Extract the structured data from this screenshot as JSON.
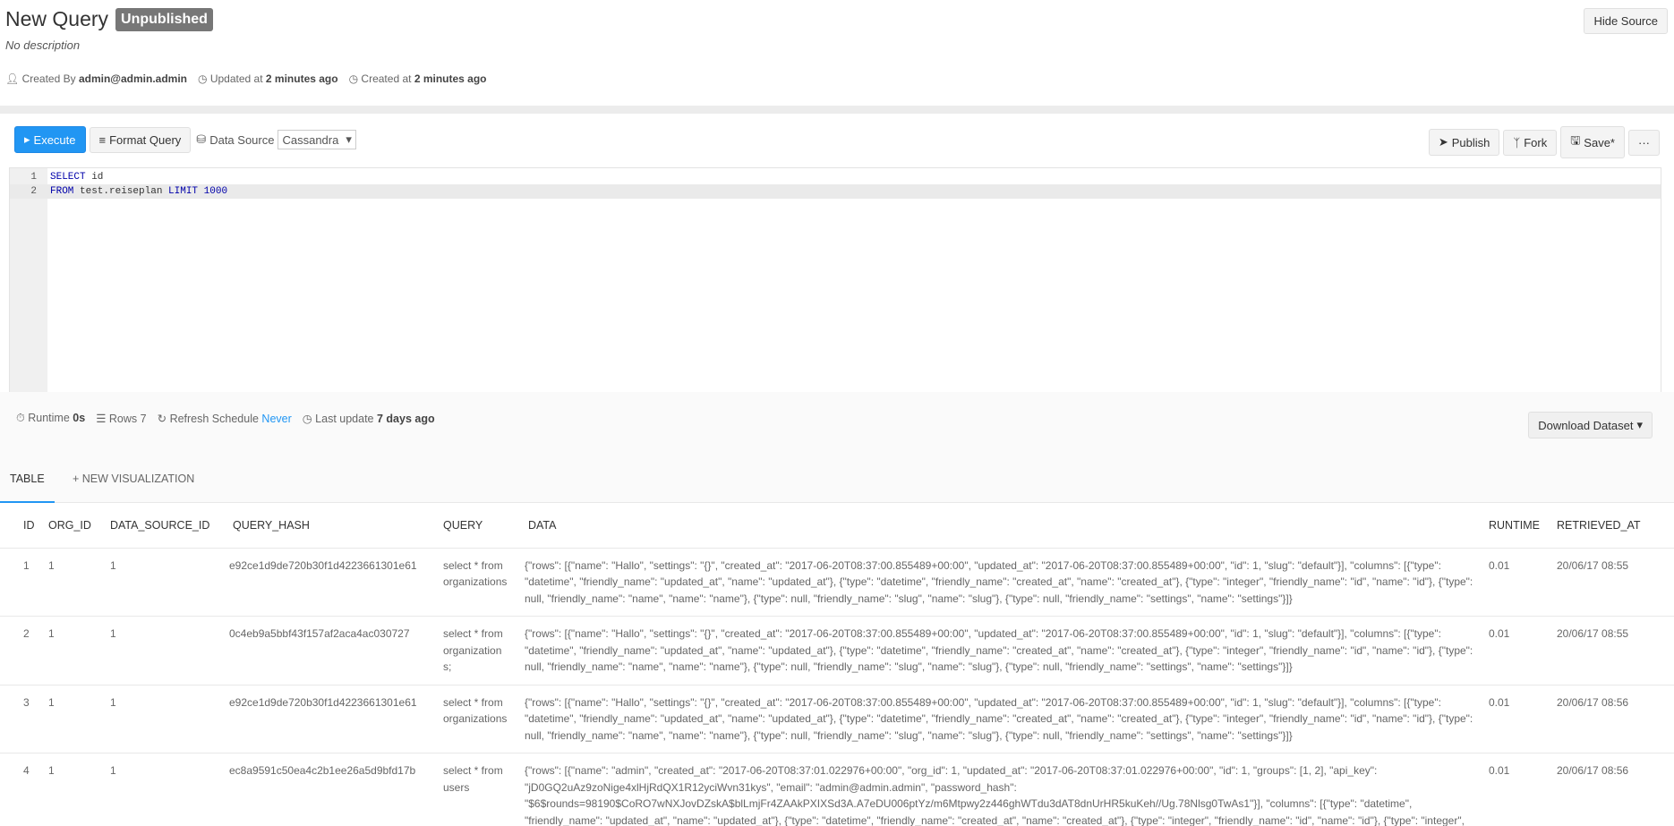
{
  "header": {
    "title": "New Query",
    "badge": "Unpublished",
    "description": "No description",
    "created_by_label": "Created By",
    "created_by": "admin@admin.admin",
    "updated_label": "Updated at",
    "updated_value": "2 minutes ago",
    "created_label": "Created at",
    "created_value": "2 minutes ago",
    "hide_source": "Hide Source"
  },
  "toolbar": {
    "execute": "Execute",
    "format_query": "Format Query",
    "data_source_label": "Data Source",
    "data_source_value": "Cassandra",
    "publish": "Publish",
    "fork": "Fork",
    "save": "Save*",
    "more": "···"
  },
  "editor": {
    "lines": [
      {
        "num": "1",
        "kw1": "SELECT",
        "rest1": " id",
        "kw2": "",
        "rest2": "",
        "num_lit": ""
      },
      {
        "num": "2",
        "kw1": "FROM",
        "rest1": " test.reiseplan ",
        "kw2": "LIMIT",
        "rest2": " ",
        "num_lit": "1000"
      }
    ]
  },
  "results_meta": {
    "runtime_label": "Runtime",
    "runtime_value": "0s",
    "rows_label": "Rows",
    "rows_value": "7",
    "refresh_label": "Refresh Schedule",
    "refresh_value": "Never",
    "last_update_label": "Last update",
    "last_update_value": "7 days ago",
    "download": "Download Dataset"
  },
  "tabs": [
    "TABLE",
    "+ NEW VISUALIZATION"
  ],
  "table": {
    "columns": [
      "ID",
      "ORG_ID",
      "DATA_SOURCE_ID",
      "QUERY_HASH",
      "QUERY",
      "DATA",
      "RUNTIME",
      "RETRIEVED_AT"
    ],
    "rows": [
      [
        "1",
        "1",
        "1",
        "e92ce1d9de720b30f1d4223661301e61",
        "select * from organizations",
        "{\"rows\": [{\"name\": \"Hallo\", \"settings\": \"{}\", \"created_at\": \"2017-06-20T08:37:00.855489+00:00\", \"updated_at\": \"2017-06-20T08:37:00.855489+00:00\", \"id\": 1, \"slug\": \"default\"}], \"columns\": [{\"type\": \"datetime\", \"friendly_name\": \"updated_at\", \"name\": \"updated_at\"}, {\"type\": \"datetime\", \"friendly_name\": \"created_at\", \"name\": \"created_at\"}, {\"type\": \"integer\", \"friendly_name\": \"id\", \"name\": \"id\"}, {\"type\": null, \"friendly_name\": \"name\", \"name\": \"name\"}, {\"type\": null, \"friendly_name\": \"slug\", \"name\": \"slug\"}, {\"type\": null, \"friendly_name\": \"settings\", \"name\": \"settings\"}]}",
        "0.01",
        "20/06/17 08:55"
      ],
      [
        "2",
        "1",
        "1",
        "0c4eb9a5bbf43f157af2aca4ac030727",
        "select * from organizations;",
        "{\"rows\": [{\"name\": \"Hallo\", \"settings\": \"{}\", \"created_at\": \"2017-06-20T08:37:00.855489+00:00\", \"updated_at\": \"2017-06-20T08:37:00.855489+00:00\", \"id\": 1, \"slug\": \"default\"}], \"columns\": [{\"type\": \"datetime\", \"friendly_name\": \"updated_at\", \"name\": \"updated_at\"}, {\"type\": \"datetime\", \"friendly_name\": \"created_at\", \"name\": \"created_at\"}, {\"type\": \"integer\", \"friendly_name\": \"id\", \"name\": \"id\"}, {\"type\": null, \"friendly_name\": \"name\", \"name\": \"name\"}, {\"type\": null, \"friendly_name\": \"slug\", \"name\": \"slug\"}, {\"type\": null, \"friendly_name\": \"settings\", \"name\": \"settings\"}]}",
        "0.01",
        "20/06/17 08:55"
      ],
      [
        "3",
        "1",
        "1",
        "e92ce1d9de720b30f1d4223661301e61",
        "select * from organizations",
        "{\"rows\": [{\"name\": \"Hallo\", \"settings\": \"{}\", \"created_at\": \"2017-06-20T08:37:00.855489+00:00\", \"updated_at\": \"2017-06-20T08:37:00.855489+00:00\", \"id\": 1, \"slug\": \"default\"}], \"columns\": [{\"type\": \"datetime\", \"friendly_name\": \"updated_at\", \"name\": \"updated_at\"}, {\"type\": \"datetime\", \"friendly_name\": \"created_at\", \"name\": \"created_at\"}, {\"type\": \"integer\", \"friendly_name\": \"id\", \"name\": \"id\"}, {\"type\": null, \"friendly_name\": \"name\", \"name\": \"name\"}, {\"type\": null, \"friendly_name\": \"slug\", \"name\": \"slug\"}, {\"type\": null, \"friendly_name\": \"settings\", \"name\": \"settings\"}]}",
        "0.01",
        "20/06/17 08:56"
      ],
      [
        "4",
        "1",
        "1",
        "ec8a9591c50ea4c2b1ee26a5d9bfd17b",
        "select * from users",
        "{\"rows\": [{\"name\": \"admin\", \"created_at\": \"2017-06-20T08:37:01.022976+00:00\", \"org_id\": 1, \"updated_at\": \"2017-06-20T08:37:01.022976+00:00\", \"id\": 1, \"groups\": [1, 2], \"api_key\": \"jD0GQ2uAz9zoNige4xlHjRdQX1R12yciWvn31kys\", \"email\": \"admin@admin.admin\", \"password_hash\": \"$6$rounds=98190$CoRO7wNXJovDZskA$blLmjFr4ZAAkPXIXSd3A.A7eDU006ptYz/m6Mtpwy2z446ghWTdu3dAT8dnUrHR5kuKeh//Ug.78Nlsg0TwAs1\"}], \"columns\": [{\"type\": \"datetime\", \"friendly_name\": \"updated_at\", \"name\": \"updated_at\"}, {\"type\": \"datetime\", \"friendly_name\": \"created_at\", \"name\": \"created_at\"}, {\"type\": \"integer\", \"friendly_name\": \"id\", \"name\": \"id\"}, {\"type\": \"integer\", \"friendly_name\": \"org_id\", \"name\": \"org_id\"}, {\"type\": null, \"friendly_name\": \"name\", \"name\": \"name\"}, {\"type\": null, \"friendly_name\": \"email\", \"name\": \"email\"}]}",
        "0.01",
        "20/06/17 08:56"
      ]
    ]
  }
}
